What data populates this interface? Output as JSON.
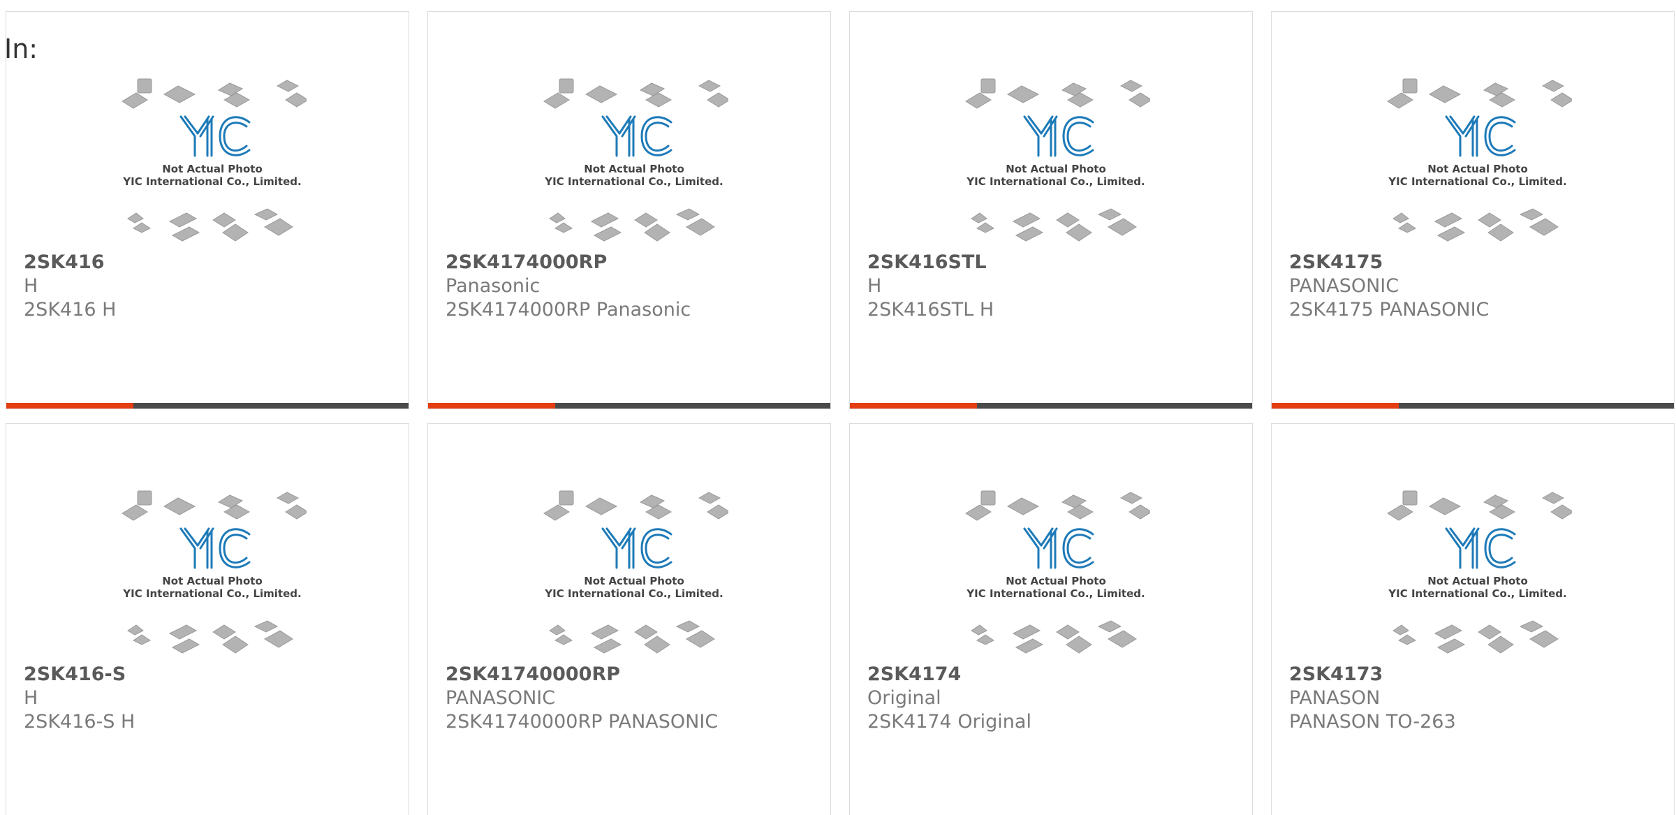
{
  "header": {
    "label": "In:"
  },
  "watermark": {
    "logo": "YIC",
    "line1": "Not Actual Photo",
    "line2": "YIC International Co., Limited."
  },
  "colors": {
    "accent": "#e43d12",
    "bar": "#4a4a4a",
    "logo": "#1d7ab8"
  },
  "products": [
    {
      "part": "2SK416",
      "mfr": "H",
      "desc": "2SK416 H"
    },
    {
      "part": "2SK4174000RP",
      "mfr": "Panasonic",
      "desc": "2SK4174000RP Panasonic"
    },
    {
      "part": "2SK416STL",
      "mfr": "H",
      "desc": "2SK416STL H"
    },
    {
      "part": "2SK4175",
      "mfr": "PANASONIC",
      "desc": "2SK4175 PANASONIC"
    },
    {
      "part": "2SK416-S",
      "mfr": "H",
      "desc": "2SK416-S H"
    },
    {
      "part": "2SK41740000RP",
      "mfr": "PANASONIC",
      "desc": "2SK41740000RP PANASONIC"
    },
    {
      "part": "2SK4174",
      "mfr": "Original",
      "desc": "2SK4174 Original"
    },
    {
      "part": "2SK4173",
      "mfr": "PANASON",
      "desc": "PANASON TO-263"
    }
  ]
}
